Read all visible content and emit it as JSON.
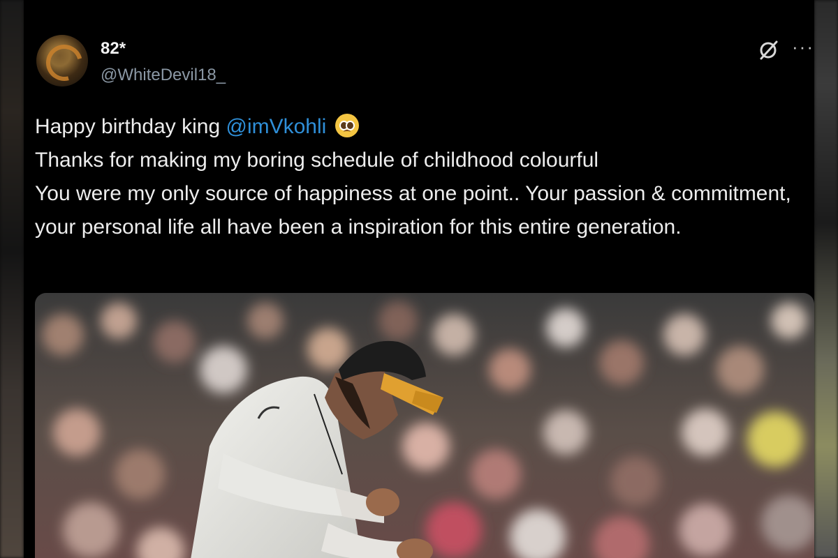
{
  "tweet": {
    "display_name": "82*",
    "handle": "@WhiteDevil18_",
    "lines": [
      {
        "prefix": "Happy birthday king ",
        "mention": "@imVkohli",
        "emoji": "pleading-face-icon"
      },
      {
        "text": "Thanks for making my boring schedule of childhood colourful"
      },
      {
        "text": "You were my only source of happiness at one point.. Your passion & commitment, your personal life all have been a inspiration for this entire generation."
      }
    ],
    "media_alt": "cricket-player-photo"
  },
  "colors": {
    "background": "#000000",
    "text": "#e7e9ea",
    "muted": "#8b98a5",
    "link": "#2f8fd8"
  },
  "icons": {
    "grok": "grok-icon",
    "more": "more-icon"
  }
}
